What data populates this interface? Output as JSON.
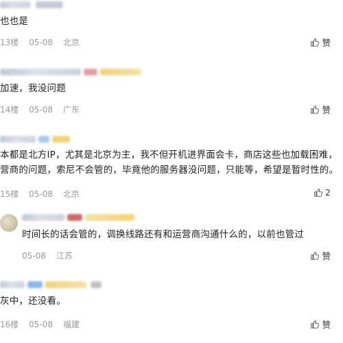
{
  "comments": [
    {
      "text": "也也是",
      "floor": "13楼",
      "date": "05-08",
      "location": "北京",
      "like_label": "赞"
    },
    {
      "text": "加速，我没问题",
      "floor": "14楼",
      "date": "05-08",
      "location": "广东",
      "like_label": "赞"
    },
    {
      "text_lines": [
        "本都是北方IP，尤其是北京为主，我不但开机进界面会卡，商店这些也加载困难，",
        "营商的问题，索尼不会管的，毕竟他的服务器没问题，只能等，希望是暂时性的。"
      ],
      "floor": "15楼",
      "date": "05-08",
      "location": "北京",
      "like_label": "2"
    },
    {
      "text": "时间长的话会管的，调换线路还有和运营商沟通什么的，以前也管过",
      "date": "05-08",
      "location": "江苏",
      "like_label": "赞"
    },
    {
      "text": "灰中，还没看。",
      "floor": "16楼",
      "date": "05-08",
      "location": "福建",
      "like_label": "赞"
    }
  ]
}
